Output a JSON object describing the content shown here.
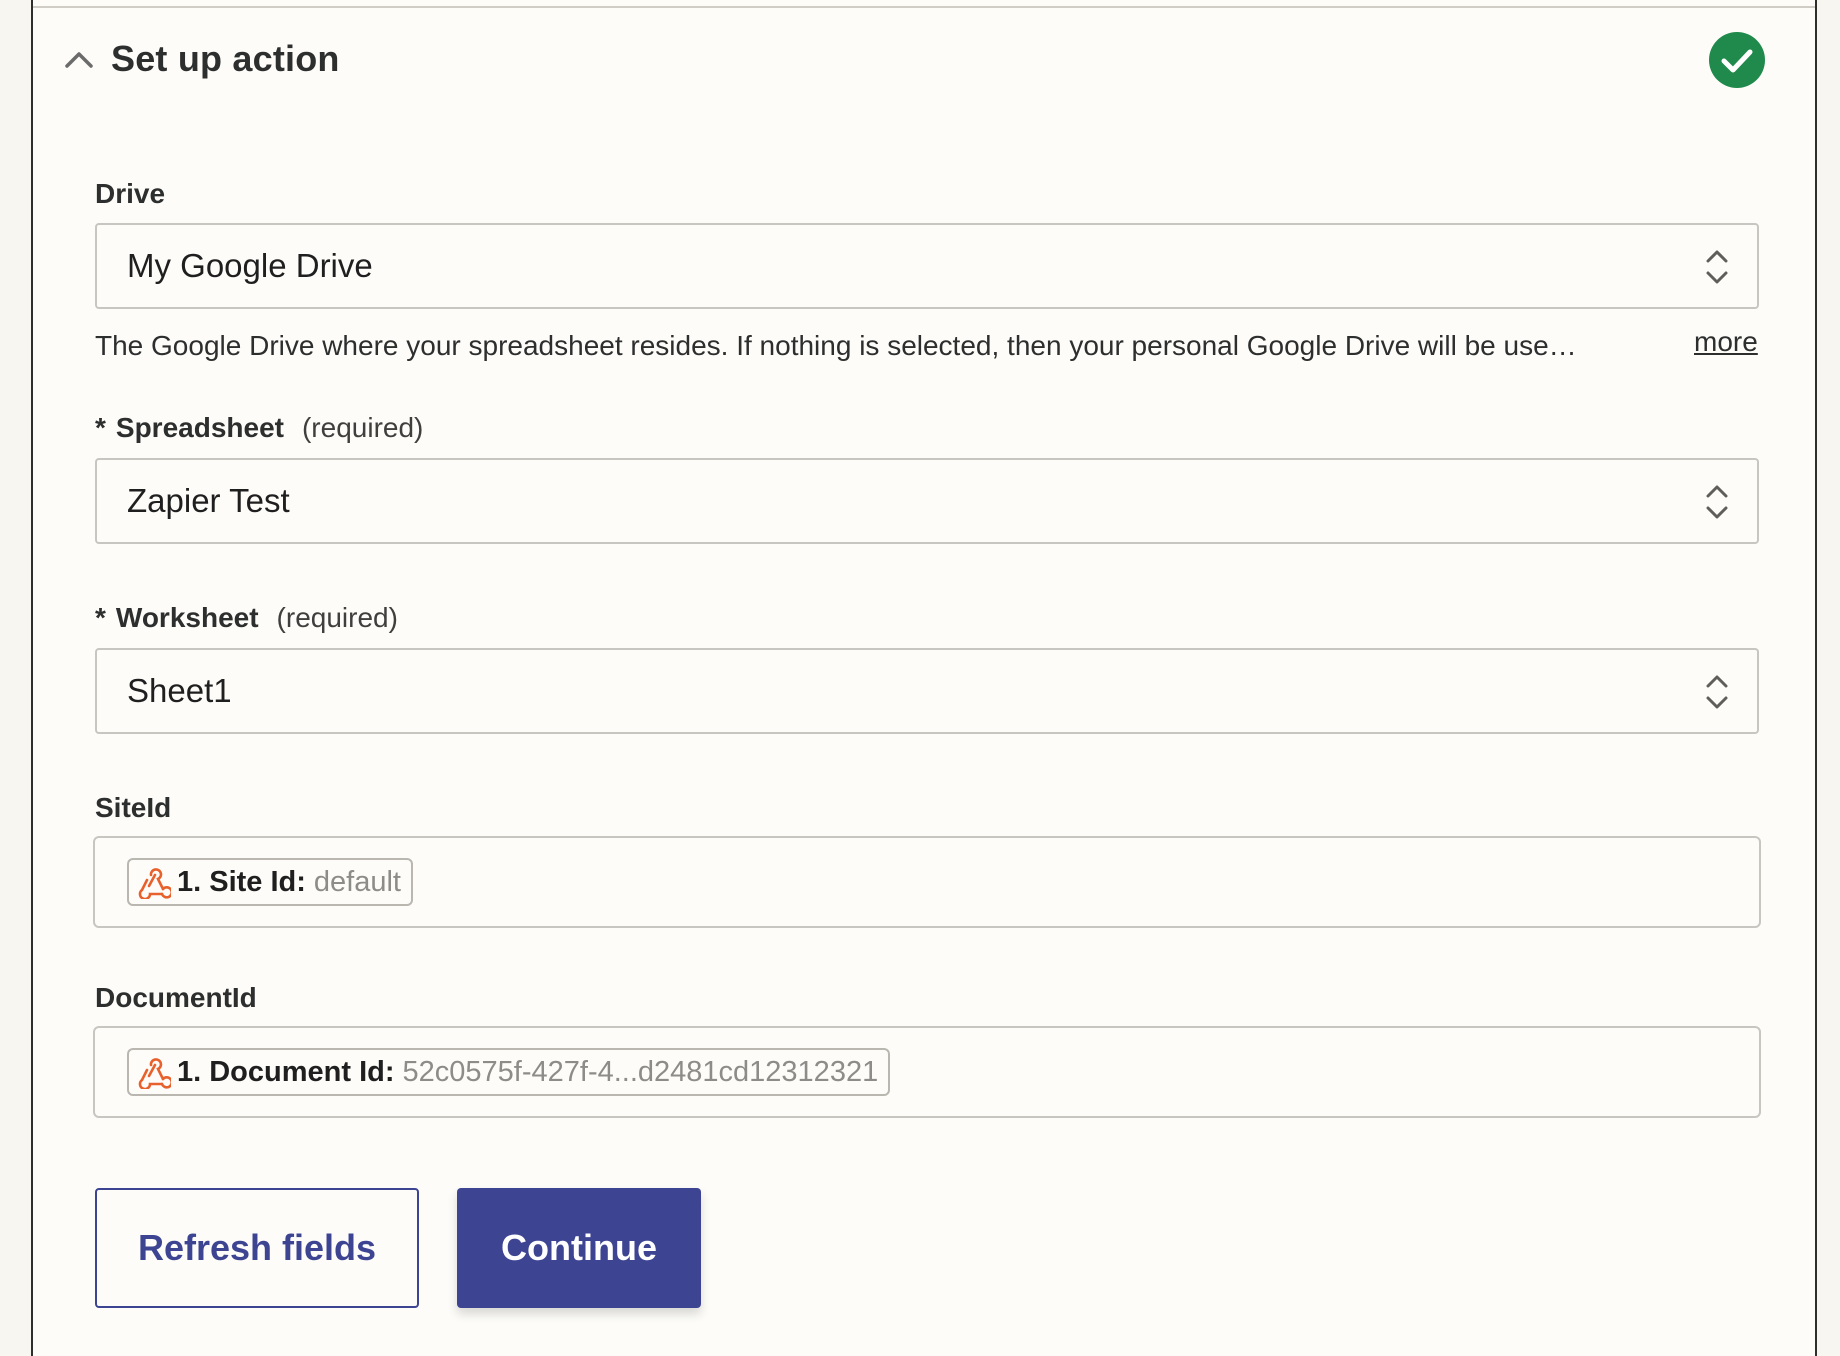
{
  "header": {
    "title": "Set up action",
    "status_color": "#1f8a4c",
    "collapse_icon": "chevron-up-icon",
    "status_icon": "check-circle-icon"
  },
  "fields": {
    "drive": {
      "label": "Drive",
      "value": "My Google Drive",
      "help": "The Google Drive where your spreadsheet resides. If nothing is selected, then your personal Google Drive will be use…",
      "more": "more"
    },
    "spreadsheet": {
      "star": "*",
      "label": "Spreadsheet",
      "required": "(required)",
      "value": "Zapier Test"
    },
    "worksheet": {
      "star": "*",
      "label": "Worksheet",
      "required": "(required)",
      "value": "Sheet1"
    },
    "site_id": {
      "label": "SiteId",
      "pill_key": "1. Site Id:",
      "pill_value": "default"
    },
    "document_id": {
      "label": "DocumentId",
      "pill_key": "1. Document Id:",
      "pill_value": "52c0575f-427f-4...d2481cd12312321"
    }
  },
  "actions": {
    "refresh_label": "Refresh fields",
    "continue_label": "Continue"
  },
  "colors": {
    "accent": "#3d4592",
    "webhook_icon": "#e8612c"
  }
}
